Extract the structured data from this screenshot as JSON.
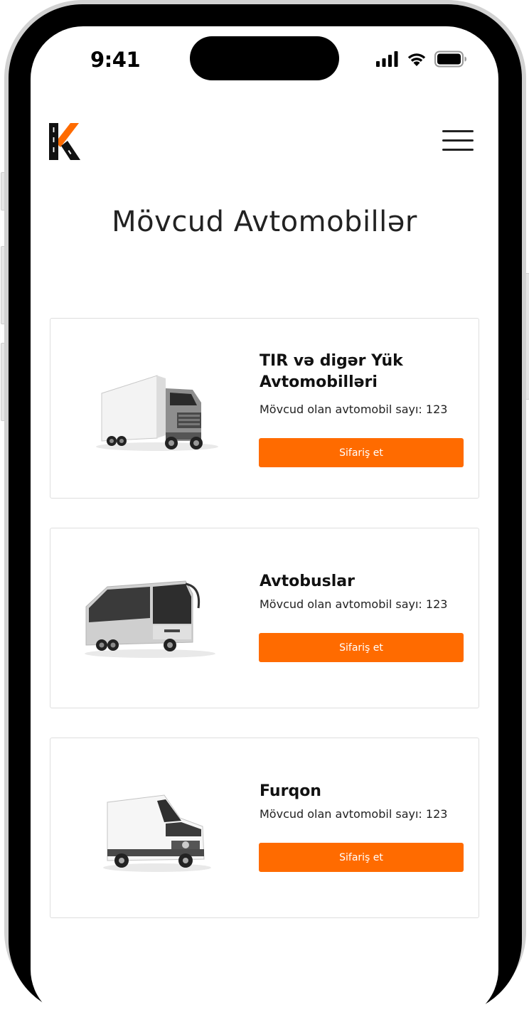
{
  "status_bar": {
    "time": "9:41"
  },
  "header": {
    "menu_icon": "hamburger-menu-icon",
    "logo_icon": "k-road-logo"
  },
  "page": {
    "title": "Mövcud Avtomobillər"
  },
  "colors": {
    "accent": "#ff6b00",
    "text": "#222222",
    "card_border": "#dedede"
  },
  "vehicles": [
    {
      "name": "TIR və digər Yük Avtomobilləri",
      "count_text": "Mövcud olan avtomobil sayı: 123",
      "button": "Sifariş et",
      "image": "truck"
    },
    {
      "name": "Avtobuslar",
      "count_text": "Mövcud olan avtomobil sayı: 123",
      "button": "Sifariş et",
      "image": "bus"
    },
    {
      "name": "Furqon",
      "count_text": "Mövcud olan avtomobil sayı: 123",
      "button": "Sifariş et",
      "image": "van"
    }
  ]
}
